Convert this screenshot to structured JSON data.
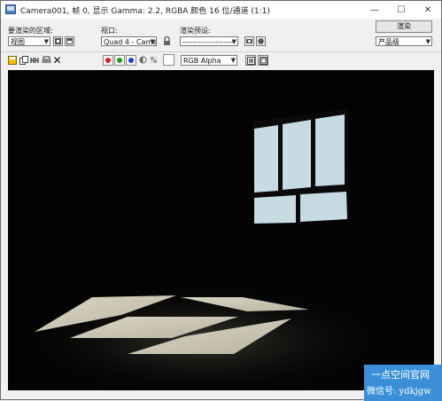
{
  "window": {
    "title": "Camera001, 帧 0, 显示 Gamma: 2.2, RGBA 颜色 16 位/通道 (1:1)",
    "minimize_icon": "minimize-icon",
    "maximize_icon": "maximize-icon",
    "close_icon": "close-icon"
  },
  "toolbar": {
    "area_label": "要渲染的区域:",
    "area_value": "视图",
    "viewport_label": "视口:",
    "viewport_value": "Quad 4 - Camera(",
    "preset_label": "渲染预设:",
    "preset_value": "--------------------",
    "render_button": "渲染",
    "production_value": "产品级"
  },
  "toolbar2": {
    "channel_value": "RGB Alpha",
    "channels": [
      {
        "name": "red",
        "color": "#e02020"
      },
      {
        "name": "green",
        "color": "#20a020"
      },
      {
        "name": "blue",
        "color": "#2040d0"
      }
    ]
  },
  "watermark": {
    "line1": "一点空间官网",
    "line2": "微信号: ydkjgw"
  }
}
